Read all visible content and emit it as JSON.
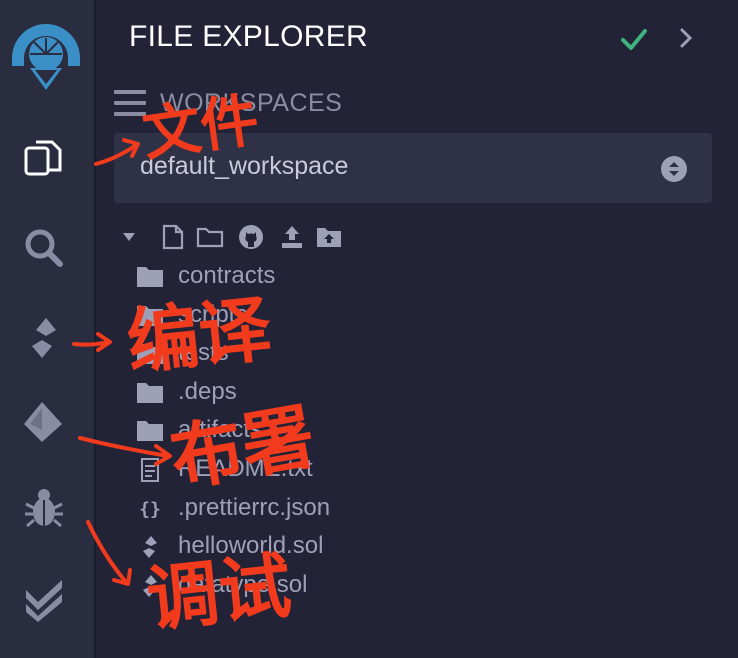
{
  "panel": {
    "title": "FILE EXPLORER",
    "workspaces_label": "WORKSPACES",
    "workspace_selected": "default_workspace"
  },
  "icons": {
    "sidebar": [
      "remix-logo-icon",
      "file-explorer-icon",
      "search-icon",
      "solidity-compiler-icon",
      "deploy-run-icon",
      "debugger-icon",
      "testing-icon"
    ],
    "toolbar": [
      "collapse-caret-icon",
      "new-file-icon",
      "new-folder-icon",
      "github-icon",
      "upload-file-icon",
      "upload-folder-icon"
    ]
  },
  "tree": [
    {
      "name": "contracts",
      "kind": "folder"
    },
    {
      "name": "scripts",
      "kind": "folder"
    },
    {
      "name": "tests",
      "kind": "folder"
    },
    {
      "name": ".deps",
      "kind": "folder"
    },
    {
      "name": "artifacts",
      "kind": "folder"
    },
    {
      "name": "README.txt",
      "kind": "text"
    },
    {
      "name": ".prettierrc.json",
      "kind": "json"
    },
    {
      "name": "helloworld.sol",
      "kind": "solidity"
    },
    {
      "name": "datatype.sol",
      "kind": "solidity"
    }
  ],
  "annotations": [
    "文件",
    "编译",
    "布署",
    "调试"
  ],
  "colors": {
    "background": "#222336",
    "sidebar": "#2a2c3f",
    "select": "#2f3146",
    "accent_check": "#3fb27f",
    "logo": "#3a8fc7",
    "annotation": "#f23a1d"
  }
}
